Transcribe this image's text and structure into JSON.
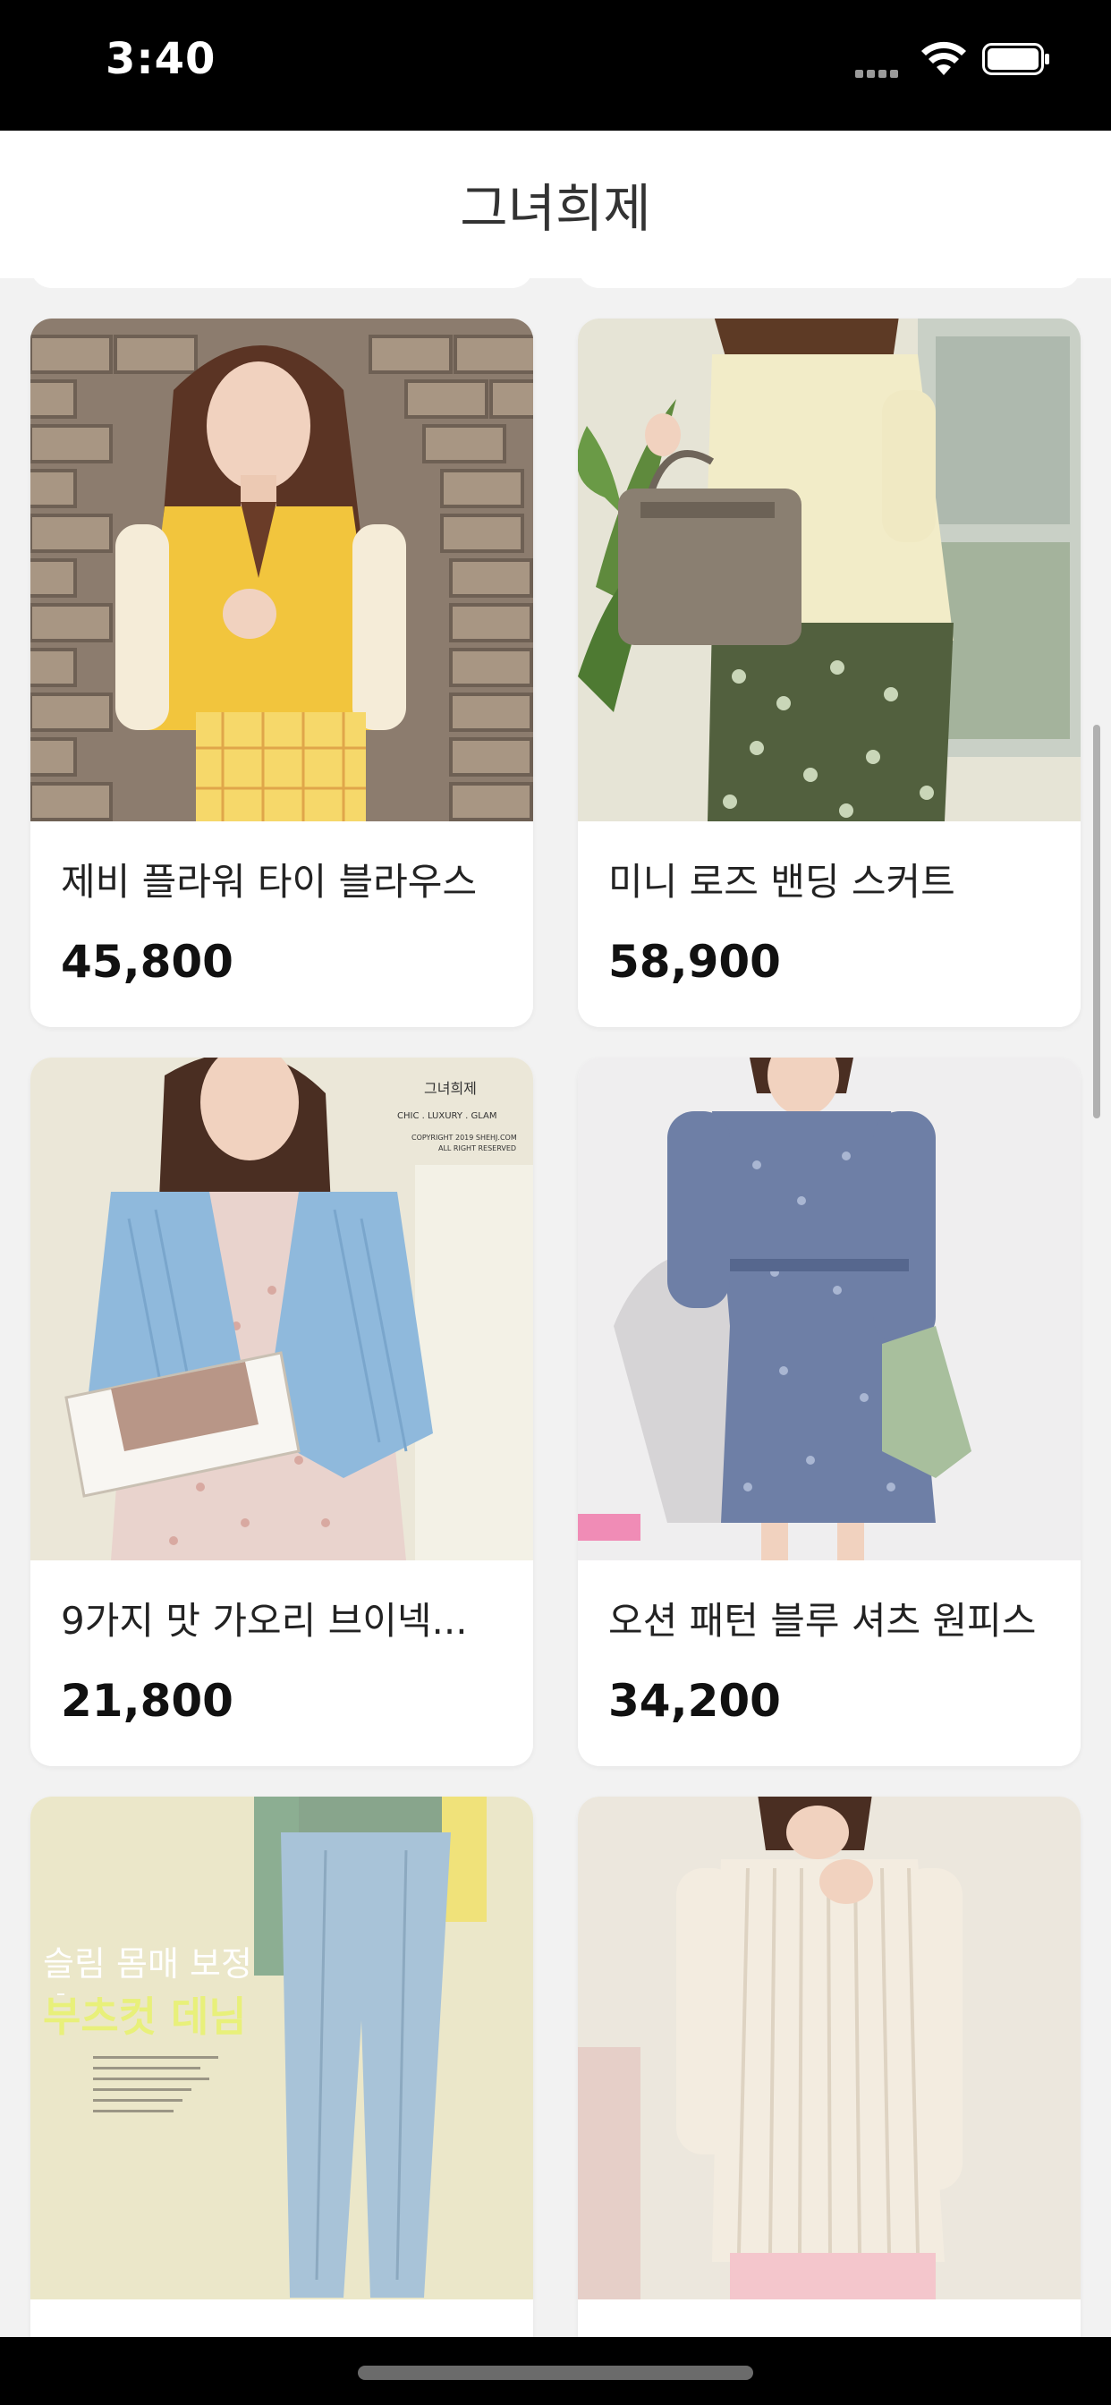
{
  "status_bar": {
    "time": "3:40"
  },
  "nav": {
    "title": "그녀희제"
  },
  "products": [
    {
      "name": "제비 플라워 타이 블라우스",
      "price": "45,800"
    },
    {
      "name": "미니 로즈 밴딩 스커트",
      "price": "58,900"
    },
    {
      "name": "9가지 맛 가오리 브이넥...",
      "price": "21,800"
    },
    {
      "name": "오션 패턴 블루 셔츠 원피스",
      "price": "34,200"
    },
    {
      "name": "",
      "price": ""
    },
    {
      "name": "",
      "price": ""
    }
  ],
  "image_text": {
    "brand_mark": "그녀희제",
    "brand_tagline": "CHIC . LUXURY . GLAM",
    "copyright_line1": "COPYRIGHT 2019 SHEHJ.COM",
    "copyright_line2": "ALL RIGHT RESERVED",
    "denim_line1": "슬림 몸매 보정",
    "denim_line2": "부츠컷 데님"
  },
  "colors": {
    "nav_bg": "#ffffff",
    "page_bg": "#f2f2f2",
    "status_bg": "#000000"
  },
  "icons": [
    "signal-icon",
    "wifi-icon",
    "battery-icon"
  ]
}
